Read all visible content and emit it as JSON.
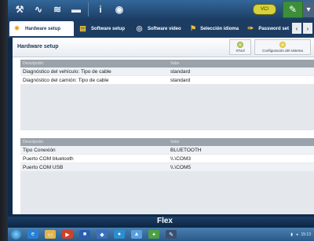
{
  "toolbar": {
    "info_label": "i",
    "logo_text": "VCI"
  },
  "tabs": [
    {
      "label": "Hardware setup",
      "icon": "gear-icon"
    },
    {
      "label": "Software setup",
      "icon": "document-icon"
    },
    {
      "label": "Software video",
      "icon": "video-icon"
    },
    {
      "label": "Selección idioma",
      "icon": "flag-icon"
    },
    {
      "label": "Password set",
      "icon": "key-icon"
    }
  ],
  "tab_nav": {
    "prev": "‹",
    "next": "›"
  },
  "panel": {
    "title": "Hardware setup",
    "buttons": [
      {
        "label": "XTool"
      },
      {
        "label": "Configuración del sistema"
      }
    ]
  },
  "table1": {
    "headers": [
      "Descripción",
      "Valor"
    ],
    "rows": [
      {
        "desc": "Diagnóstico del vehículo: Tipo de cable",
        "value": "standard"
      },
      {
        "desc": "Diagnóstico del camión: Tipo de cable",
        "value": "standard"
      }
    ]
  },
  "table2": {
    "headers": [
      "Descripción",
      "Valor"
    ],
    "rows": [
      {
        "desc": "Tipo Conexión",
        "value": "BLUETOOTH"
      },
      {
        "desc": "Puerto COM bluetooth",
        "value": "\\\\.\\COM3"
      },
      {
        "desc": "Puerto COM USB",
        "value": "\\\\.\\COM5"
      }
    ]
  },
  "footer": {
    "label": "Flex"
  },
  "tray": {
    "time": "15:13"
  },
  "colors": {
    "accent": "#1c3c62",
    "active_tab": "#ffffff",
    "header_gray": "#9aa2ab"
  }
}
